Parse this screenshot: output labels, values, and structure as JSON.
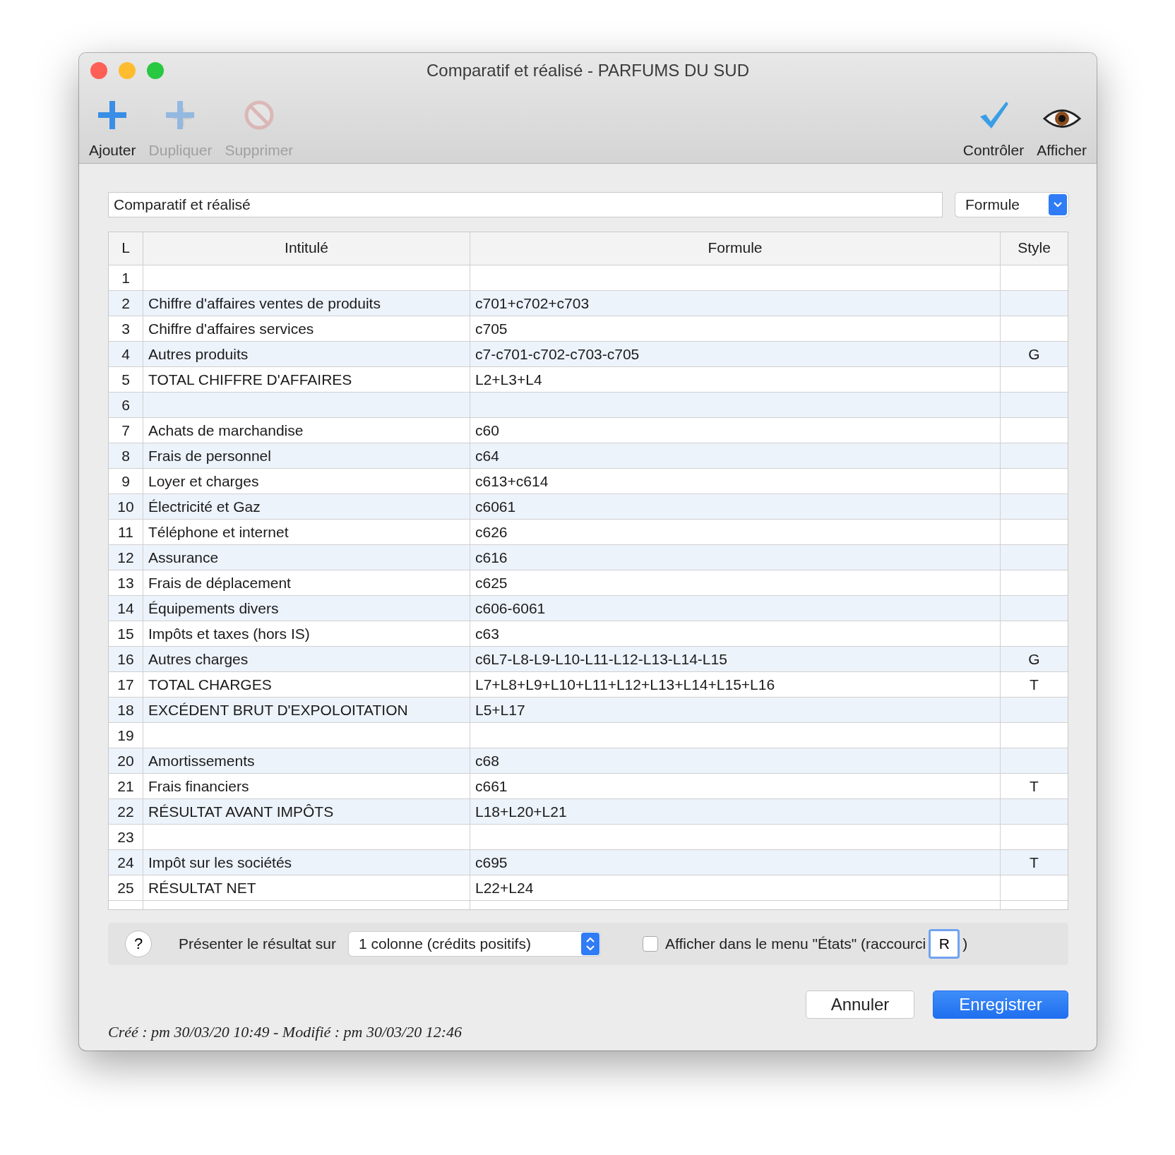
{
  "window": {
    "title": "Comparatif et réalisé - PARFUMS DU SUD"
  },
  "toolbar_left": [
    {
      "kind": "add",
      "label": "Ajouter",
      "disabled": false
    },
    {
      "kind": "duplicate",
      "label": "Dupliquer",
      "disabled": true
    },
    {
      "kind": "delete",
      "label": "Supprimer",
      "disabled": true
    }
  ],
  "toolbar_right": [
    {
      "kind": "check",
      "label": "Contrôler",
      "disabled": false
    },
    {
      "kind": "view",
      "label": "Afficher",
      "disabled": false
    }
  ],
  "name_field": {
    "value": "Comparatif et réalisé"
  },
  "type_dropdown": {
    "value": "Formule"
  },
  "table": {
    "columns": [
      "L",
      "Intitulé",
      "Formule",
      "Style"
    ],
    "rows": [
      [
        "1",
        "",
        "",
        ""
      ],
      [
        "2",
        "Chiffre d'affaires ventes de produits",
        "c701+c702+c703",
        ""
      ],
      [
        "3",
        "Chiffre d'affaires services",
        "c705",
        ""
      ],
      [
        "4",
        "Autres produits",
        "c7-c701-c702-c703-c705",
        "G"
      ],
      [
        "5",
        "TOTAL CHIFFRE D'AFFAIRES",
        "L2+L3+L4",
        ""
      ],
      [
        "6",
        "",
        "",
        ""
      ],
      [
        "7",
        "Achats de marchandise",
        "c60",
        ""
      ],
      [
        "8",
        "Frais de personnel",
        "c64",
        ""
      ],
      [
        "9",
        "Loyer et charges",
        "c613+c614",
        ""
      ],
      [
        "10",
        "Électricité et Gaz",
        "c6061",
        ""
      ],
      [
        "11",
        "Téléphone et internet",
        "c626",
        ""
      ],
      [
        "12",
        "Assurance",
        "c616",
        ""
      ],
      [
        "13",
        "Frais de déplacement",
        "c625",
        ""
      ],
      [
        "14",
        "Équipements divers",
        "c606-6061",
        ""
      ],
      [
        "15",
        "Impôts et taxes (hors IS)",
        "c63",
        ""
      ],
      [
        "16",
        "Autres charges",
        "c6L7-L8-L9-L10-L11-L12-L13-L14-L15",
        "G"
      ],
      [
        "17",
        "TOTAL CHARGES",
        "L7+L8+L9+L10+L11+L12+L13+L14+L15+L16",
        "T"
      ],
      [
        "18",
        "EXCÉDENT BRUT D'EXPOLOITATION",
        "L5+L17",
        ""
      ],
      [
        "19",
        "",
        "",
        ""
      ],
      [
        "20",
        "Amortissements",
        "c68",
        ""
      ],
      [
        "21",
        "Frais financiers",
        "c661",
        "T"
      ],
      [
        "22",
        "RÉSULTAT AVANT IMPÔTS",
        "L18+L20+L21",
        ""
      ],
      [
        "23",
        "",
        "",
        ""
      ],
      [
        "24",
        "Impôt sur les sociétés",
        "c695",
        "T"
      ],
      [
        "25",
        "RÉSULTAT NET",
        "L22+L24",
        ""
      ]
    ]
  },
  "options": {
    "help": "?",
    "present_label": "Présenter le résultat sur",
    "present_select": "1 colonne (crédits positifs)",
    "menu_checkbox": {
      "label": "Afficher dans le menu \"États\" (raccourci",
      "checked": false
    },
    "shortcut": "R",
    "shortcut_close": ")"
  },
  "buttons": [
    {
      "label": "Annuler",
      "primary": false
    },
    {
      "label": "Enregistrer",
      "primary": true
    }
  ],
  "footer": "Créé : pm 30/03/20 10:49 - Modifié : pm 30/03/20 12:46"
}
